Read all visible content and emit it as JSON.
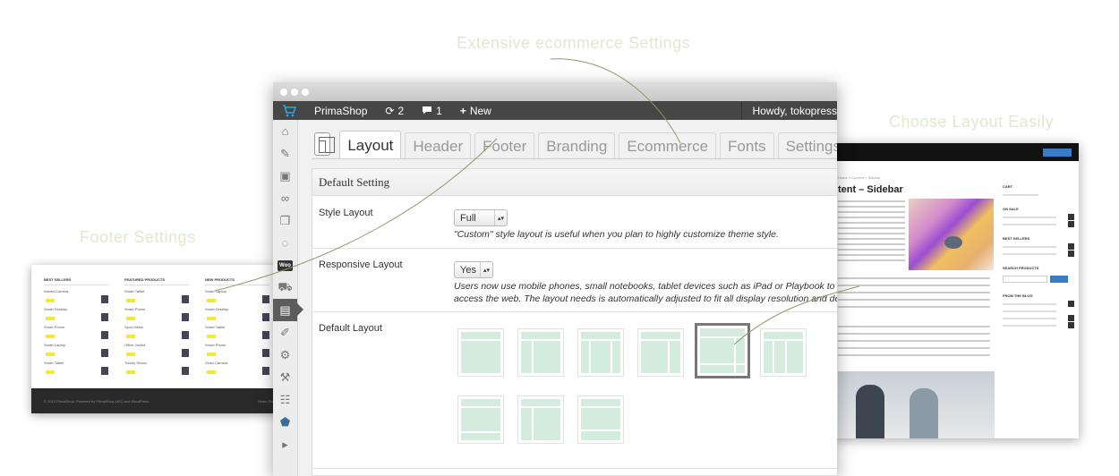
{
  "callouts": {
    "ecommerce": "Extensive ecommerce Settings",
    "layout": "Choose Layout Easily",
    "footer": "Footer Settings"
  },
  "colors": {
    "admin_bar": "#464646",
    "layout_fill": "#d4ecde",
    "callout_text": "#dfe9cf",
    "accent": "#2aa7e0"
  },
  "admin_bar": {
    "site": "PrimaShop",
    "updates": "2",
    "comments": "1",
    "new_label": "New",
    "howdy": "Howdy, tokopress",
    "logo_icon": "cart-icon"
  },
  "side_menu": [
    "home-icon",
    "pin-icon",
    "media-icon",
    "links-icon",
    "pages-icon",
    "comments-icon",
    "woo-icon",
    "products-icon",
    "theme-options-icon",
    "appearance-icon",
    "plugins-icon",
    "tools-icon",
    "settings-icon",
    "shield-icon",
    "play-icon"
  ],
  "woo_label": "Woo",
  "tabs": [
    "Layout",
    "Header",
    "Footer",
    "Branding",
    "Ecommerce",
    "Fonts",
    "Settings"
  ],
  "active_tab": "Layout",
  "panel": {
    "heading": "Default Setting",
    "style_layout": {
      "label": "Style Layout",
      "value": "Full",
      "help": "\"Custom\" style layout is useful when you plan to highly customize theme style."
    },
    "responsive_layout": {
      "label": "Responsive Layout",
      "value": "Yes",
      "help_line1": "Users now use mobile phones, small notebooks, tablet devices such as iPad or Playbook to",
      "help_line2": "access the web. The layout needs is automatically adjusted to fit all display resolution and device"
    },
    "default_layout": {
      "label": "Default Layout",
      "selected_index": 4
    }
  },
  "right_preview": {
    "breadcrumb": "Home » Content » Sidebar",
    "title": "tent – Sidebar",
    "sidebar_heads": [
      "CART",
      "ON SALE",
      "BEST SELLERS",
      "SEARCH PRODUCTS",
      "FROM THE BLOG"
    ]
  },
  "left_preview": {
    "columns": [
      {
        "title": "BEST SELLERS",
        "items": [
          "Instant Camera",
          "Smart Desktop",
          "Smart Phone",
          "Smart Laptop",
          "Smart Tablet"
        ]
      },
      {
        "title": "FEATURED PRODUCTS",
        "items": [
          "Smart Tablet",
          "Smart Phone",
          "Sport Heels",
          "Office Jacket",
          "Trendy Shoes"
        ]
      },
      {
        "title": "NEW PRODUCTS",
        "items": [
          "Smart Laptop",
          "Smart Desktop",
          "Smart Tablet",
          "Smart Phone",
          "Video Camera"
        ]
      }
    ],
    "footer_text": "© 2013 PrimaShop. Powered by PrimaShop (WC) and WordPress.",
    "footer_links": "Home   Shop   Blog"
  }
}
